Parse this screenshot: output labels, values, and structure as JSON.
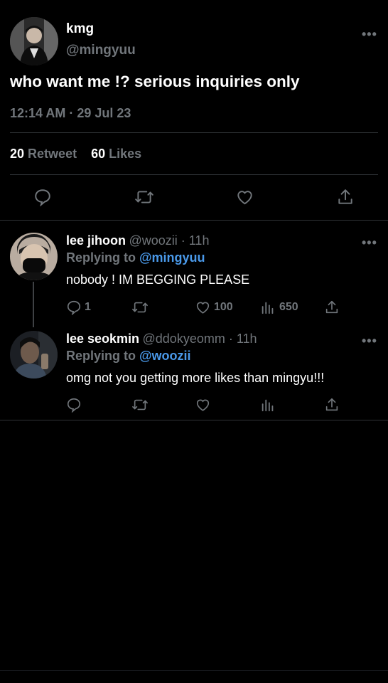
{
  "main_tweet": {
    "display_name": "kmg",
    "handle": "@mingyuu",
    "text": "who want me !? serious inquiries only",
    "timestamp": "12:14 AM · 29 Jul 23",
    "retweet_count": "20",
    "retweet_label": "Retweet",
    "likes_count": "60",
    "likes_label": "Likes",
    "more_label": "•••"
  },
  "replies": [
    {
      "display_name": "lee jihoon",
      "handle_time": "@woozii · 11h",
      "replying_prefix": "Replying to ",
      "replying_to": "@mingyuu",
      "text": "nobody ! IM BEGGING PLEASE",
      "reply_count": "1",
      "like_count": "100",
      "view_count": "650",
      "more_label": "•••"
    },
    {
      "display_name": "lee seokmin",
      "handle_time": "@ddokyeomm · 11h",
      "replying_prefix": "Replying to ",
      "replying_to": "@woozii",
      "text": "omg not you getting more likes than mingyu!!!",
      "more_label": "•••"
    }
  ],
  "icons": [
    "reply-icon",
    "retweet-icon",
    "like-icon",
    "share-icon",
    "views-icon",
    "more-icon"
  ],
  "colors": {
    "background": "#000000",
    "text": "#e7e9ea",
    "secondary": "#71767b",
    "mention": "#4a99e9",
    "divider": "#2f3336"
  }
}
